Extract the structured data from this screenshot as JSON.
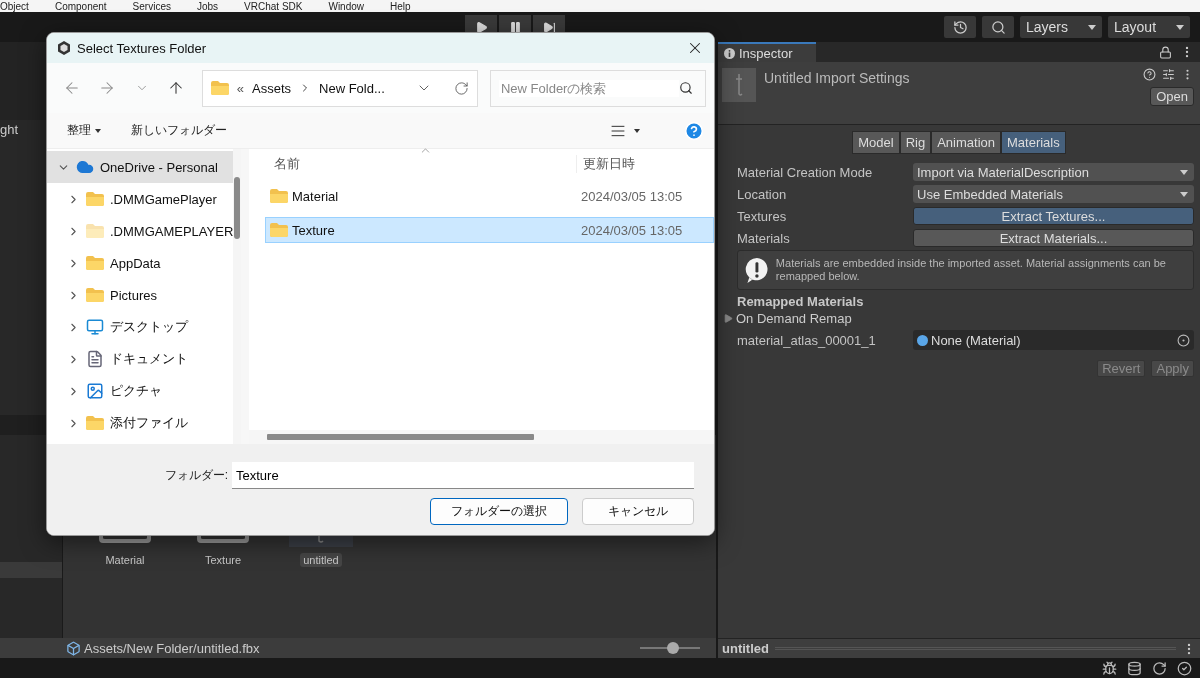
{
  "menu_bar": {
    "items": [
      "Object",
      "Component",
      "Services",
      "Jobs",
      "VRChat SDK",
      "Window",
      "Help"
    ]
  },
  "toolbar": {
    "layers": "Layers",
    "layout": "Layout"
  },
  "hierarchy": {
    "partial_label": "ght"
  },
  "project": {
    "assets": [
      {
        "name": "Material",
        "kind": "folder",
        "selected": false
      },
      {
        "name": "Texture",
        "kind": "folder",
        "selected": false
      },
      {
        "name": "untitled",
        "kind": "model",
        "selected": true
      }
    ],
    "path": "Assets/New Folder/untitled.fbx",
    "zoom": {
      "level": 0.55
    }
  },
  "inspector": {
    "tab": "Inspector",
    "title": "Untitled Import Settings",
    "open_button": "Open",
    "tabs": [
      {
        "label": "Model",
        "selected": false
      },
      {
        "label": "Rig",
        "selected": false
      },
      {
        "label": "Animation",
        "selected": false
      },
      {
        "label": "Materials",
        "selected": true
      }
    ],
    "properties": [
      {
        "kind": "dropdown",
        "label": "Material Creation Mode",
        "value": "Import via MaterialDescription",
        "focused": false
      },
      {
        "kind": "dropdown",
        "label": "Location",
        "value": "Use Embedded Materials",
        "focused": false
      },
      {
        "kind": "button",
        "label": "Textures",
        "value": "Extract Textures...",
        "focused": true
      },
      {
        "kind": "button",
        "label": "Materials",
        "value": "Extract Materials...",
        "focused": false
      }
    ],
    "help_text": "Materials are embedded inside the imported asset. Material assignments can be remapped below.",
    "section": "Remapped Materials",
    "foldout": {
      "label": "On Demand Remap",
      "expanded": false
    },
    "remap": {
      "label": "material_atlas_00001_1",
      "value": "None (Material)"
    },
    "buttons": [
      {
        "label": "Revert",
        "disabled": true
      },
      {
        "label": "Apply",
        "disabled": true
      }
    ],
    "preview_title": "untitled"
  },
  "dialog": {
    "title": "Select Textures Folder",
    "address": {
      "overflow": "«",
      "segments": [
        "Assets",
        "New Fold..."
      ]
    },
    "search_placeholder": "New Folderの検索",
    "commands": [
      {
        "label": "整理",
        "dropdown": true
      },
      {
        "label": "新しいフォルダー",
        "dropdown": false
      }
    ],
    "nav": [
      {
        "label": "OneDrive - Personal",
        "kind": "cloud",
        "selected": true,
        "expanded": true,
        "children": [
          {
            "label": ".DMMGamePlayer",
            "kind": "folder",
            "selected": false,
            "expanded": false,
            "hidden": false
          },
          {
            "label": ".DMMGAMEPLAYER",
            "kind": "folder",
            "selected": false,
            "expanded": false,
            "hidden": true
          },
          {
            "label": "AppData",
            "kind": "folder",
            "selected": false,
            "expanded": false,
            "hidden": false
          },
          {
            "label": "Pictures",
            "kind": "folder",
            "selected": false,
            "expanded": false,
            "hidden": false
          },
          {
            "label": "デスクトップ",
            "kind": "desktop",
            "selected": false,
            "expanded": false
          },
          {
            "label": "ドキュメント",
            "kind": "documents",
            "selected": false,
            "expanded": false
          },
          {
            "label": "ピクチャ",
            "kind": "pictures",
            "selected": false,
            "expanded": false
          },
          {
            "label": "添付ファイル",
            "kind": "folder",
            "selected": false,
            "expanded": false,
            "hidden": false
          }
        ]
      }
    ],
    "columns": [
      "名前",
      "更新日時"
    ],
    "files": [
      {
        "name": "Material",
        "modified": "2024/03/05 13:05",
        "selected": false
      },
      {
        "name": "Texture",
        "modified": "2024/03/05 13:05",
        "selected": true
      }
    ],
    "folder_label": "フォルダー:",
    "folder_value": "Texture",
    "buttons": [
      {
        "label": "フォルダーの選択",
        "primary": true
      },
      {
        "label": "キャンセル",
        "primary": false
      }
    ]
  }
}
